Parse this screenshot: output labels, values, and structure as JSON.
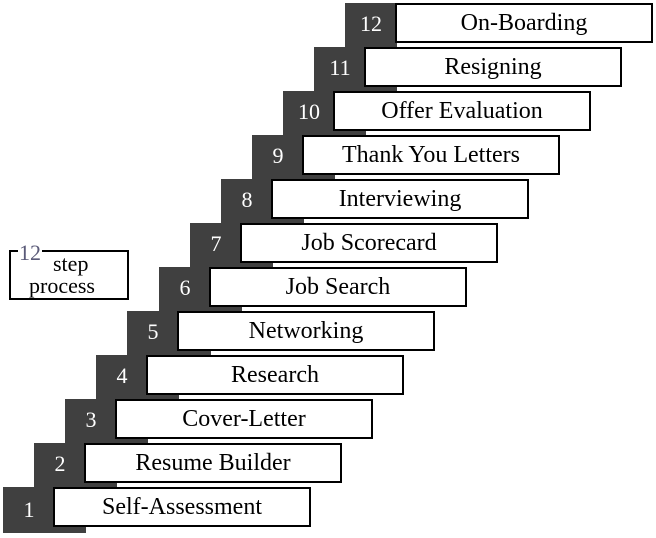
{
  "legend": {
    "number": "12",
    "line1": "step",
    "line2": "process"
  },
  "colors": {
    "step_number_bg": "#404040",
    "step_number_text": "#ffffff",
    "box_border": "#000000",
    "legend_number": "#5a5a78"
  },
  "steps": [
    {
      "number": "1",
      "label": "Self-Assessment"
    },
    {
      "number": "2",
      "label": "Resume Builder"
    },
    {
      "number": "3",
      "label": "Cover-Letter"
    },
    {
      "number": "4",
      "label": "Research"
    },
    {
      "number": "5",
      "label": "Networking"
    },
    {
      "number": "6",
      "label": "Job Search"
    },
    {
      "number": "7",
      "label": "Job Scorecard"
    },
    {
      "number": "8",
      "label": "Interviewing"
    },
    {
      "number": "9",
      "label": "Thank You Letters"
    },
    {
      "number": "10",
      "label": "Offer Evaluation"
    },
    {
      "number": "11",
      "label": "Resigning"
    },
    {
      "number": "12",
      "label": "On-Boarding"
    }
  ]
}
